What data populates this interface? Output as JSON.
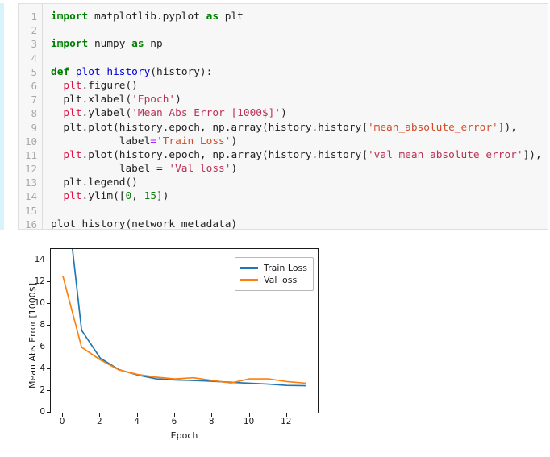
{
  "notebook": {
    "cell": {
      "selected": true,
      "selection_color": "#d8f3fb",
      "background": "#f7f7f7",
      "border_color": "#dfdfdf",
      "line_numbers": [
        "1",
        "2",
        "3",
        "4",
        "5",
        "6",
        "7",
        "8",
        "9",
        "10",
        "11",
        "12",
        "13",
        "14",
        "15",
        "16"
      ],
      "code_lines": [
        [
          {
            "t": "import",
            "c": "kw"
          },
          {
            "t": " matplotlib.pyplot ",
            "c": "plain"
          },
          {
            "t": "as",
            "c": "kw"
          },
          {
            "t": " plt",
            "c": "plain"
          }
        ],
        [],
        [
          {
            "t": "import",
            "c": "kw"
          },
          {
            "t": " numpy ",
            "c": "plain"
          },
          {
            "t": "as",
            "c": "kw"
          },
          {
            "t": " np",
            "c": "plain"
          }
        ],
        [],
        [
          {
            "t": "def",
            "c": "kw"
          },
          {
            "t": " ",
            "c": "plain"
          },
          {
            "t": "plot_history",
            "c": "fn"
          },
          {
            "t": "(history):",
            "c": "plain"
          }
        ],
        [
          {
            "t": "  ",
            "c": "plain"
          },
          {
            "t": "plt",
            "c": "mod"
          },
          {
            "t": ".figure()",
            "c": "plain"
          }
        ],
        [
          {
            "t": "  plt.xlabel(",
            "c": "plain"
          },
          {
            "t": "'Epoch'",
            "c": "str"
          },
          {
            "t": ")",
            "c": "plain"
          }
        ],
        [
          {
            "t": "  ",
            "c": "plain"
          },
          {
            "t": "plt",
            "c": "mod"
          },
          {
            "t": ".ylabel(",
            "c": "plain"
          },
          {
            "t": "'Mean Abs Error [1000$]'",
            "c": "str"
          },
          {
            "t": ")",
            "c": "plain"
          }
        ],
        [
          {
            "t": "  plt.plot(history.epoch, np.array(history.history[",
            "c": "plain"
          },
          {
            "t": "'mean_absolute_error'",
            "c": "str2"
          },
          {
            "t": "]),",
            "c": "plain"
          }
        ],
        [
          {
            "t": "           label",
            "c": "plain"
          },
          {
            "t": "=",
            "c": "op"
          },
          {
            "t": "'Train Loss'",
            "c": "str2"
          },
          {
            "t": ")",
            "c": "plain"
          }
        ],
        [
          {
            "t": "  ",
            "c": "plain"
          },
          {
            "t": "plt",
            "c": "mod"
          },
          {
            "t": ".plot(history.epoch, np.array(history.history[",
            "c": "plain"
          },
          {
            "t": "'val_mean_absolute_error'",
            "c": "str"
          },
          {
            "t": "]),",
            "c": "plain"
          }
        ],
        [
          {
            "t": "           label = ",
            "c": "plain"
          },
          {
            "t": "'Val loss'",
            "c": "str"
          },
          {
            "t": ")",
            "c": "plain"
          }
        ],
        [
          {
            "t": "  plt.legend()",
            "c": "plain"
          }
        ],
        [
          {
            "t": "  ",
            "c": "plain"
          },
          {
            "t": "plt",
            "c": "mod"
          },
          {
            "t": ".ylim([",
            "c": "plain"
          },
          {
            "t": "0",
            "c": "num"
          },
          {
            "t": ", ",
            "c": "plain"
          },
          {
            "t": "15",
            "c": "num"
          },
          {
            "t": "])",
            "c": "plain"
          }
        ],
        [],
        [
          {
            "t": "plot_history(network_metadata)",
            "c": "plain"
          }
        ]
      ]
    }
  },
  "chart_data": {
    "type": "line",
    "title": "",
    "xlabel": "Epoch",
    "ylabel": "Mean Abs Error [1000$]",
    "xlim": [
      -0.65,
      13.65
    ],
    "ylim": [
      0,
      15
    ],
    "xticks": [
      0,
      2,
      4,
      6,
      8,
      10,
      12
    ],
    "yticks": [
      0,
      2,
      4,
      6,
      8,
      10,
      12,
      14
    ],
    "grid": false,
    "legend_position": "upper right",
    "x": [
      0,
      1,
      2,
      3,
      4,
      5,
      6,
      7,
      8,
      9,
      10,
      11,
      12,
      13
    ],
    "series": [
      {
        "name": "Train Loss",
        "color": "#1f77b4",
        "values": [
          22.8,
          7.55,
          5.0,
          3.95,
          3.45,
          3.1,
          3.0,
          2.95,
          2.88,
          2.78,
          2.7,
          2.62,
          2.5,
          2.47
        ]
      },
      {
        "name": "Val loss",
        "color": "#ff7f0e",
        "values": [
          12.5,
          6.0,
          4.85,
          3.92,
          3.5,
          3.25,
          3.1,
          3.2,
          2.95,
          2.72,
          3.1,
          3.1,
          2.85,
          2.7
        ]
      }
    ]
  }
}
